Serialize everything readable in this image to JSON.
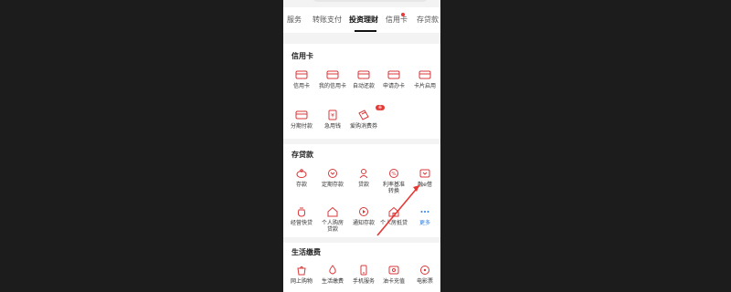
{
  "tabs": [
    "服务",
    "转账支付",
    "投资理财",
    "信用卡",
    "存贷款"
  ],
  "sections": {
    "credit": {
      "title": "信用卡",
      "items": [
        "信用卡",
        "我的信用卡",
        "自动还款",
        "申请办卡",
        "卡片启用",
        "分期付款",
        "急用钱",
        "爱购消费券"
      ],
      "badge": "券"
    },
    "deposit": {
      "title": "存贷款",
      "items": [
        "存款",
        "定期存款",
        "贷款",
        "利率基准转换",
        "融e借",
        "经营快贷",
        "个人购房贷款",
        "通知存款",
        "个人房抵贷",
        "更多"
      ]
    },
    "life": {
      "title": "生活缴费",
      "items": [
        "网上购物",
        "生活缴费",
        "手机服务",
        "油卡充值",
        "电影票"
      ]
    }
  },
  "colors": {
    "accent": "#d9383a",
    "link": "#2a7de1"
  }
}
